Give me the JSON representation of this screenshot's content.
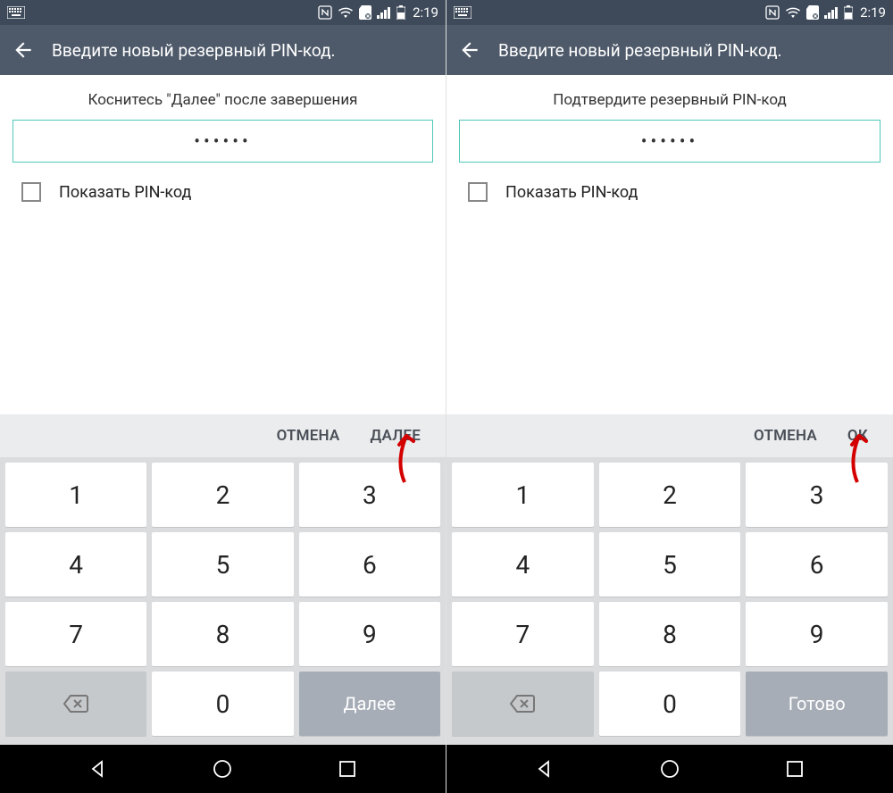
{
  "statusbar": {
    "time": "2:19"
  },
  "screens": [
    {
      "title": "Введите новый резервный PIN-код.",
      "instruction": "Коснитесь \"Далее\" после завершения",
      "pin_masked": "••••••",
      "checkbox_label": "Показать PIN-код",
      "cancel": "ОТМЕНА",
      "confirm": "ДАЛЕЕ",
      "keypad_action": "Далее"
    },
    {
      "title": "Введите новый резервный PIN-код.",
      "instruction": "Подтвердите резервный PIN-код",
      "pin_masked": "••••••",
      "checkbox_label": "Показать PIN-код",
      "cancel": "ОТМЕНА",
      "confirm": "ОК",
      "keypad_action": "Готово"
    }
  ],
  "keypad": {
    "keys": [
      "1",
      "2",
      "3",
      "4",
      "5",
      "6",
      "7",
      "8",
      "9",
      "",
      "0",
      ""
    ]
  }
}
